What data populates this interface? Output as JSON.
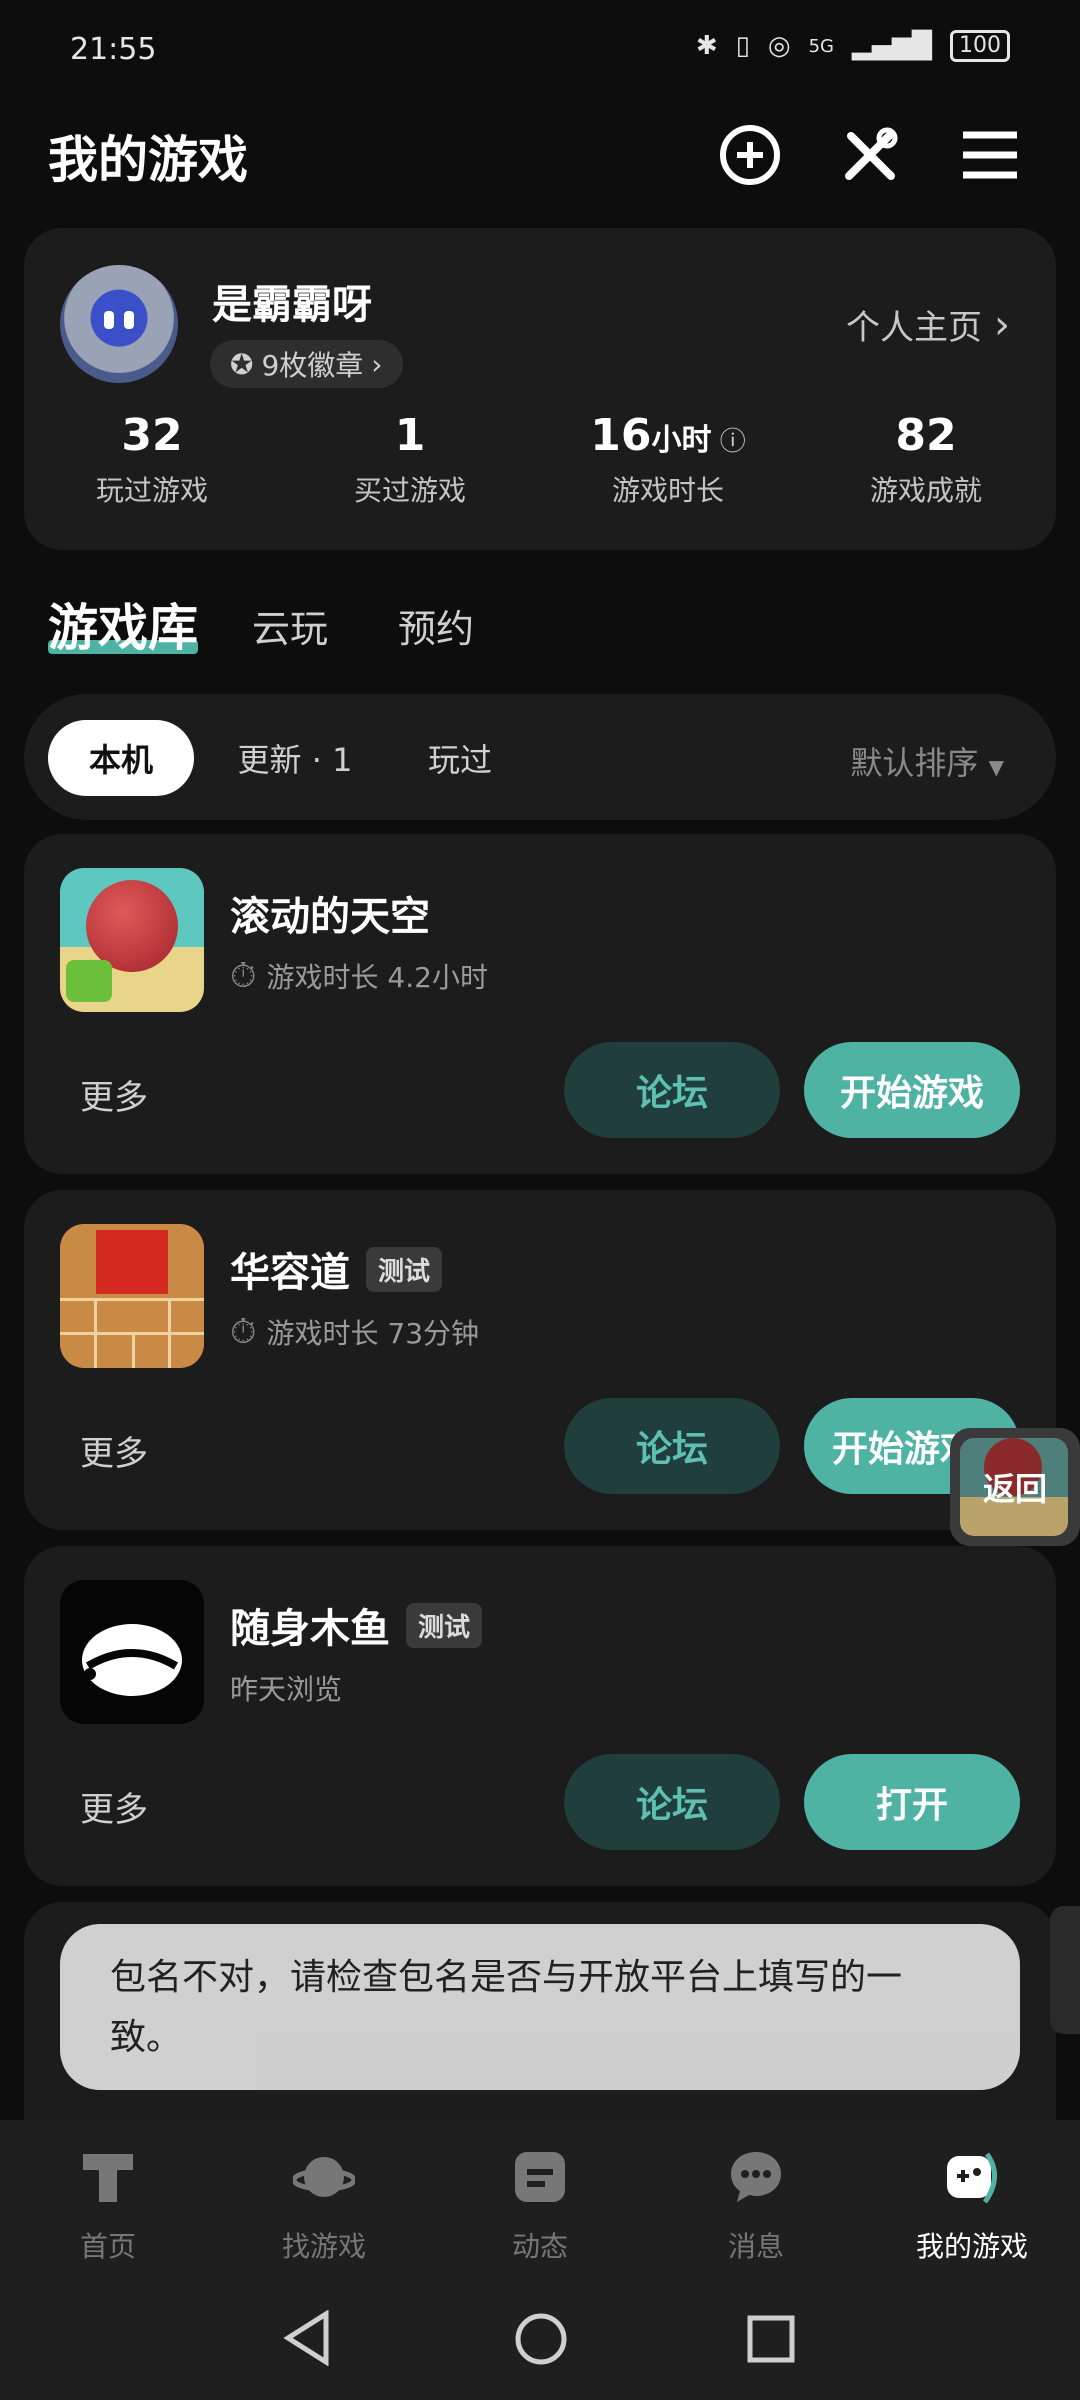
{
  "status_bar": {
    "time": "21:55",
    "network": "5G",
    "battery": "100"
  },
  "header": {
    "title": "我的游戏"
  },
  "profile": {
    "username": "是霸霸呀",
    "badges": "9枚徽章",
    "homepage_link": "个人主页",
    "stats": [
      {
        "value": "32",
        "unit": "",
        "label": "玩过游戏"
      },
      {
        "value": "1",
        "unit": "",
        "label": "买过游戏"
      },
      {
        "value": "16",
        "unit": "小时",
        "label": "游戏时长"
      },
      {
        "value": "82",
        "unit": "",
        "label": "游戏成就"
      }
    ]
  },
  "library_tabs": [
    "游戏库",
    "云玩",
    "预约"
  ],
  "filters": {
    "chips": [
      "本机",
      "更新 · 1",
      "玩过"
    ],
    "sort": "默认排序"
  },
  "games": [
    {
      "name": "滚动的天空",
      "tag": "",
      "sub": "游戏时长 4.2小时",
      "more": "更多",
      "forum": "论坛",
      "action": "开始游戏"
    },
    {
      "name": "华容道",
      "tag": "测试",
      "sub": "游戏时长 73分钟",
      "more": "更多",
      "forum": "论坛",
      "action": "开始游戏"
    },
    {
      "name": "随身木鱼",
      "tag": "测试",
      "sub": "昨天浏览",
      "more": "更多",
      "forum": "论坛",
      "action": "打开"
    }
  ],
  "float_back": "返回",
  "toast": "包名不对，请检查包名是否与开放平台上填写的一致。",
  "bottom_nav": [
    "首页",
    "找游戏",
    "动态",
    "消息",
    "我的游戏"
  ],
  "colors": {
    "accent": "#4fb3a4",
    "forum_bg": "#203e3c",
    "card": "#1c1c1c"
  }
}
